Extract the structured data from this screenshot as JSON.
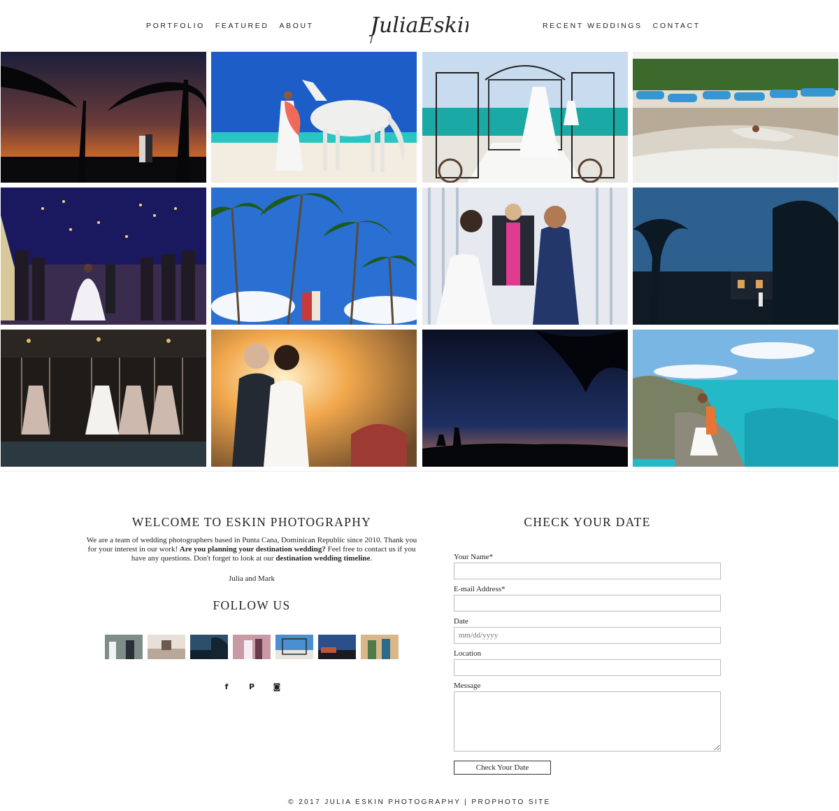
{
  "header": {
    "nav_left": [
      "PORTFOLIO",
      "FEATURED",
      "ABOUT"
    ],
    "nav_right": [
      "RECENT WEDDINGS",
      "CONTACT"
    ],
    "logo_text": "JuliaEskin"
  },
  "gallery": {
    "photos": [
      {
        "subject": "palm-silhouette-sunset"
      },
      {
        "subject": "bride-white-horse-beach"
      },
      {
        "subject": "ceremony-gazebo-dress"
      },
      {
        "subject": "couple-lying-on-beach-boats"
      },
      {
        "subject": "sparkler-exit-night"
      },
      {
        "subject": "palm-trees-blue-sky-couple"
      },
      {
        "subject": "ceremony-ring-exchange"
      },
      {
        "subject": "night-palms-house"
      },
      {
        "subject": "bridesmaids-on-swings"
      },
      {
        "subject": "couple-embrace-golden-light"
      },
      {
        "subject": "couple-silhouette-dusk"
      },
      {
        "subject": "couple-on-cliff-turquoise-sea"
      }
    ]
  },
  "welcome": {
    "title": "WELCOME TO ESKIN PHOTOGRAPHY",
    "text_1": "We are a team of wedding photographers based in Punta Cana, Dominican Republic since 2010. Thank you for your interest in our work! ",
    "text_bold_1": "Are you planning your destination wedding?",
    "text_2": " Feel free to contact us if you have any questions. Don't forget to look at our ",
    "text_bold_2": "destination wedding timeline",
    "text_3": ".",
    "signature": "Julia and Mark"
  },
  "follow": {
    "title": "FOLLOW US",
    "thumbs": 7,
    "social": [
      {
        "name": "facebook-icon",
        "glyph": "f"
      },
      {
        "name": "pinterest-icon",
        "glyph": "P"
      },
      {
        "name": "instagram-icon",
        "glyph": "◙"
      }
    ]
  },
  "form": {
    "title": "CHECK YOUR DATE",
    "name_label": "Your Name*",
    "email_label": "E-mail Address*",
    "date_label": "Date",
    "date_placeholder": "mm/dd/yyyy",
    "location_label": "Location",
    "message_label": "Message",
    "submit_label": "Check Your Date"
  },
  "footer": {
    "text": "© 2017 JULIA ESKIN PHOTOGRAPHY | PROPHOTO SITE"
  }
}
